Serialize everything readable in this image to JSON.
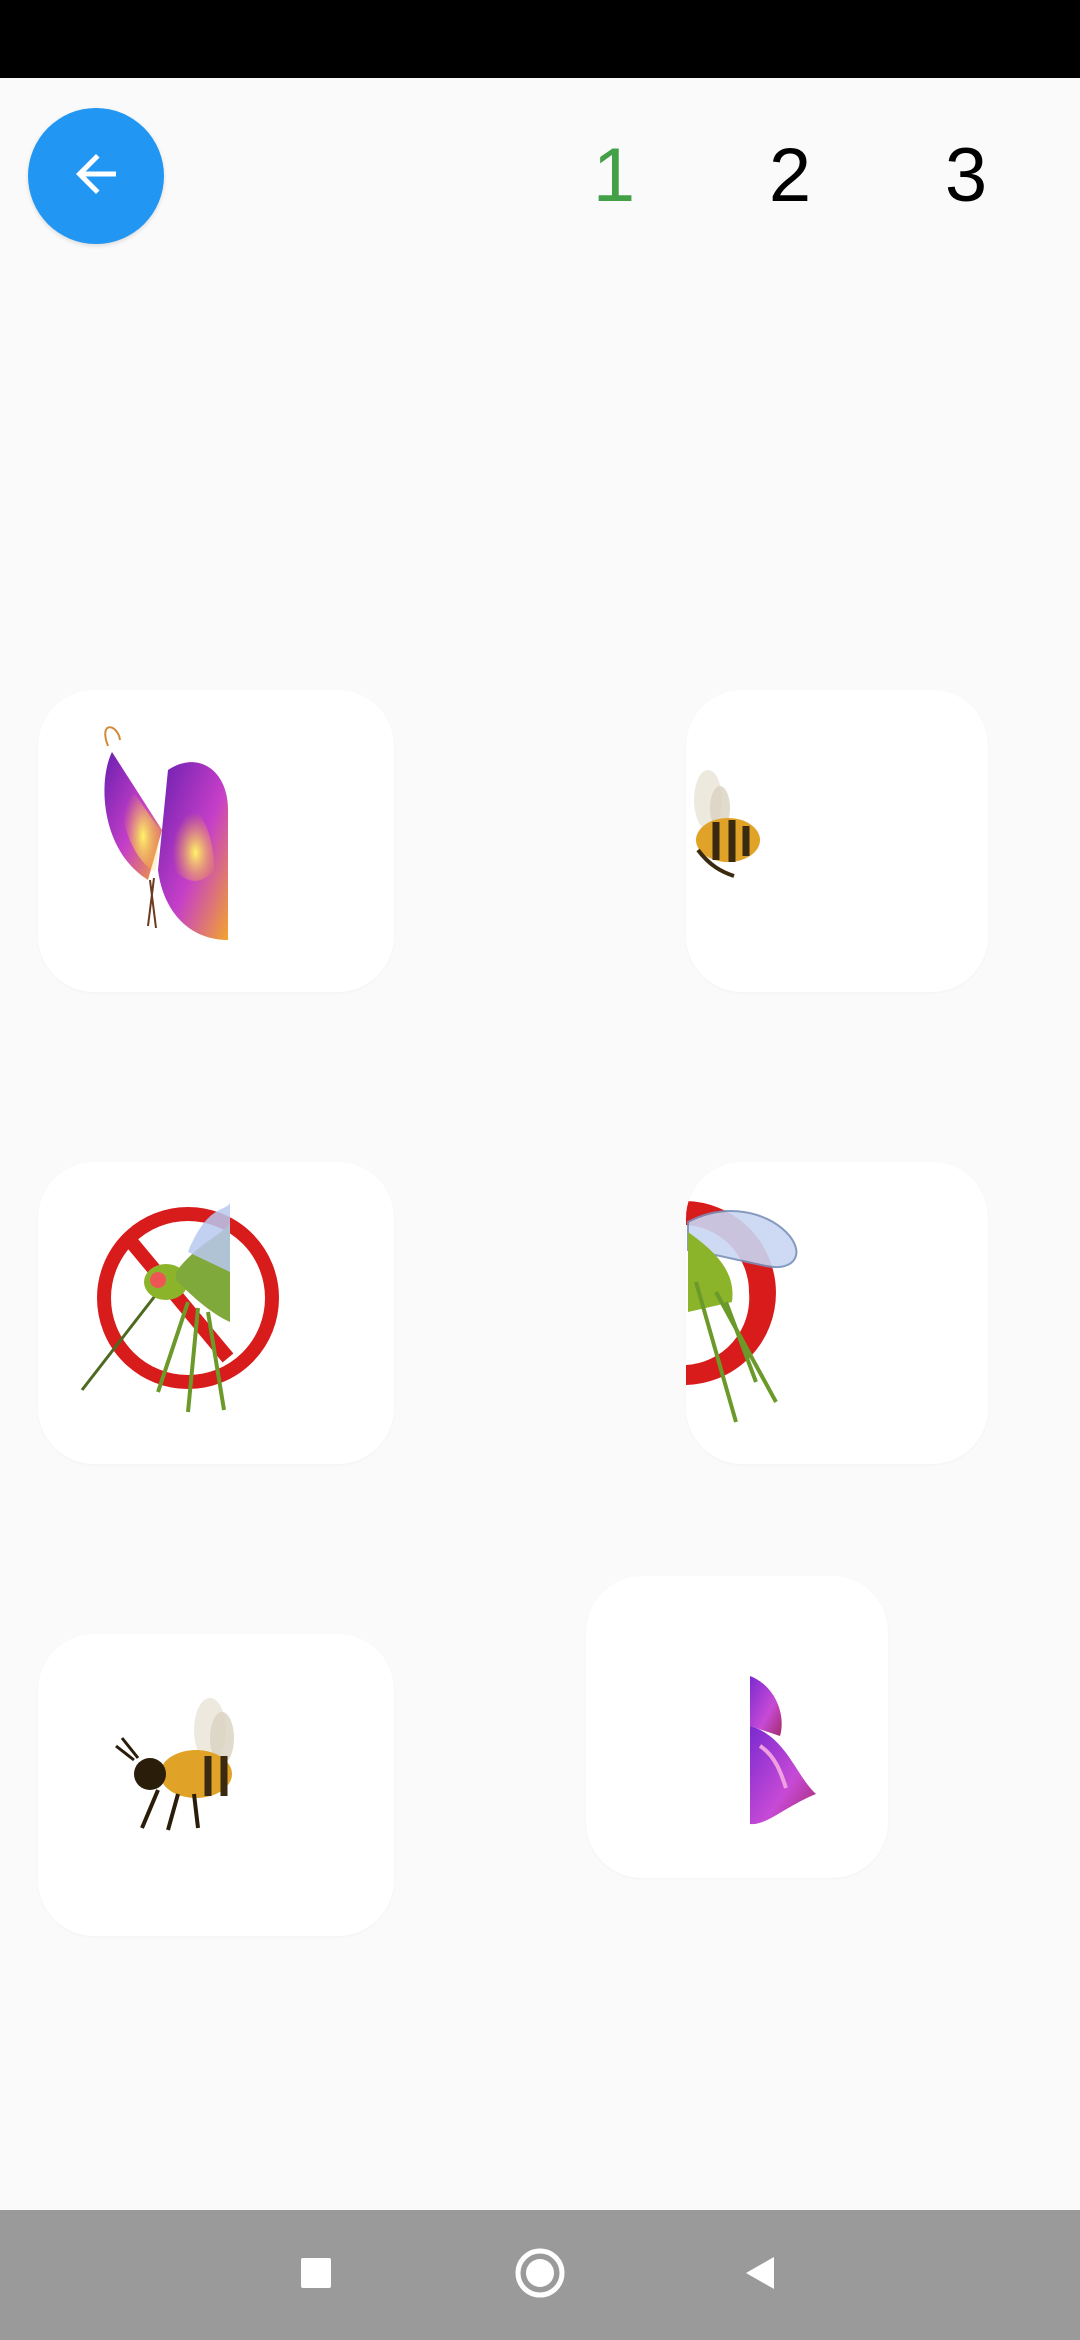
{
  "header": {
    "back_icon": "arrow-left-icon",
    "levels": [
      {
        "label": "1",
        "active": true
      },
      {
        "label": "2",
        "active": false
      },
      {
        "label": "3",
        "active": false
      }
    ]
  },
  "colors": {
    "accent": "#2196f3",
    "active_level": "#43a047",
    "background": "#fafafa",
    "card": "#ffffff"
  },
  "puzzle_pieces": [
    {
      "subject": "butterfly",
      "half": "left"
    },
    {
      "subject": "bee",
      "half": "right"
    },
    {
      "subject": "mosquito",
      "half": "left"
    },
    {
      "subject": "mosquito",
      "half": "right"
    },
    {
      "subject": "bee",
      "half": "left"
    },
    {
      "subject": "butterfly",
      "half": "right"
    }
  ],
  "nav_bar": {
    "icons": [
      "square-recents-icon",
      "circle-home-icon",
      "triangle-back-icon"
    ]
  }
}
